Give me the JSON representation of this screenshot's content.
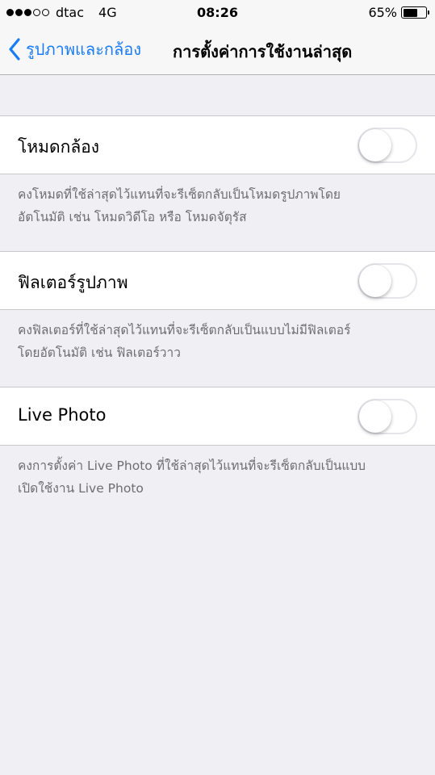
{
  "status_bar": {
    "signal_filled": 3,
    "signal_empty": 2,
    "carrier": "dtac",
    "network": "4G",
    "time": "08:26",
    "battery_percent": "65%",
    "battery_level": 0.65
  },
  "nav": {
    "back_label": "รูปภาพและกล้อง",
    "title": "การตั้งค่าการใช้งานล่าสุด",
    "accent_color": "#1a7bf6"
  },
  "settings": [
    {
      "label": "โหมดกล้อง",
      "enabled": false,
      "footer": [
        "คงโหมดที่ใช้ล่าสุดไว้แทนที่จะรีเซ็ตกลับเป็นโหมดรูปภาพโดย",
        "อัตโนมัติ เช่น โหมดวิดีโอ หรือ โหมดจัตุรัส"
      ]
    },
    {
      "label": "ฟิลเตอร์รูปภาพ",
      "enabled": false,
      "footer": [
        "คงฟิลเตอร์ที่ใช้ล่าสุดไว้แทนที่จะรีเซ็ตกลับเป็นแบบไม่มีฟิลเตอร์",
        "โดยอัตโนมัติ เช่น ฟิลเตอร์วาว"
      ]
    },
    {
      "label": "Live Photo",
      "enabled": false,
      "footer": [
        "คงการตั้งค่า Live Photo ที่ใช้ล่าสุดไว้แทนที่จะรีเซ็ตกลับเป็นแบบ",
        "เปิดใช้งาน Live Photo"
      ]
    }
  ]
}
